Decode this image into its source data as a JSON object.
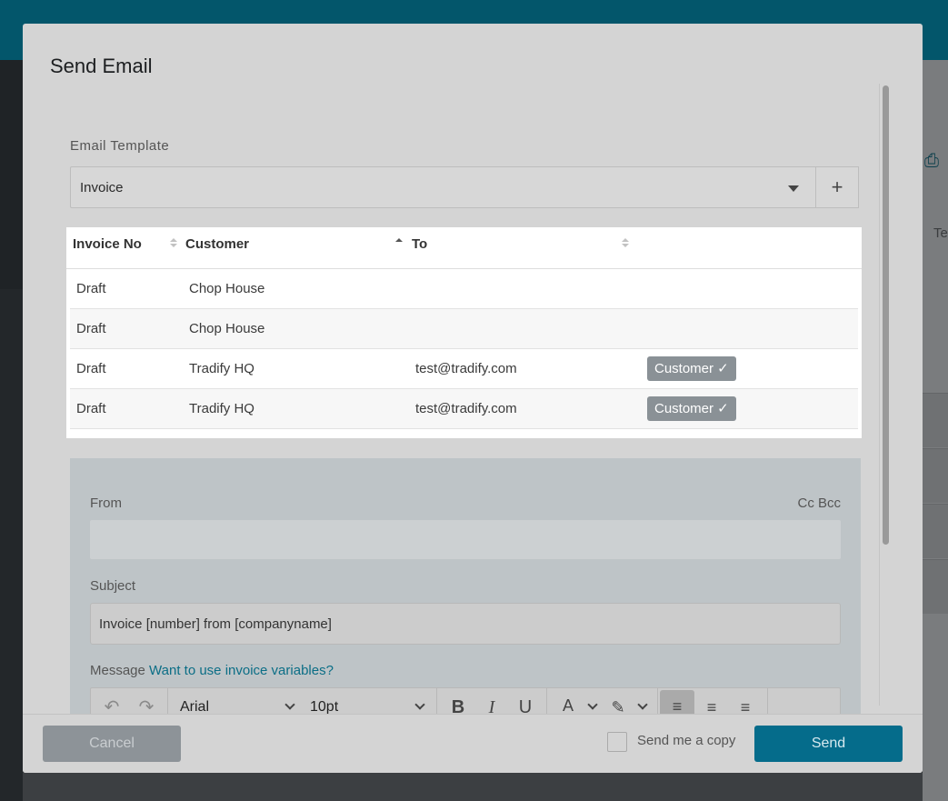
{
  "dialog": {
    "title": "Send Email"
  },
  "template": {
    "label": "Email Template",
    "selected": "Invoice",
    "add_label": "+"
  },
  "table": {
    "columns": [
      "Invoice No",
      "Customer",
      "To",
      ""
    ],
    "sort": {
      "column": "Customer",
      "direction": "ascending"
    },
    "rows": [
      {
        "invoice_no": "Draft",
        "customer": "Chop House",
        "to": "",
        "badge": ""
      },
      {
        "invoice_no": "Draft",
        "customer": "Chop House",
        "to": "",
        "badge": ""
      },
      {
        "invoice_no": "Draft",
        "customer": "Tradify HQ",
        "to": "test@tradify.com",
        "badge": "Customer ✓"
      },
      {
        "invoice_no": "Draft",
        "customer": "Tradify HQ",
        "to": "test@tradify.com",
        "badge": "Customer ✓"
      }
    ]
  },
  "email": {
    "from_label": "From",
    "cc_bcc_label": "Cc Bcc",
    "from_value": "",
    "subject_label": "Subject",
    "subject_value": "Invoice [number] from [companyname]",
    "message_label": "Message",
    "variables_link": "Want to use invoice variables?"
  },
  "editor_toolbar": {
    "undo_icon": "undo-icon",
    "redo_icon": "redo-icon",
    "font_family": "Arial",
    "font_size": "10pt",
    "bold": "B",
    "italic": "I",
    "underline": "U",
    "text_color_glyph": "A",
    "highlight_icon": "highlighter-icon",
    "align": [
      "align-left-icon",
      "align-center-icon",
      "align-right-icon"
    ],
    "active_align": "left"
  },
  "footer": {
    "cancel_label": "Cancel",
    "send_copy_label": "Send me a copy",
    "send_copy_checked": false,
    "send_label": "Send"
  },
  "background": {
    "tab_text": "Te"
  },
  "colors": {
    "primary": "#056c8b",
    "link": "#0b6e86",
    "badge": "#8a9196",
    "topbar": "#03566b"
  }
}
